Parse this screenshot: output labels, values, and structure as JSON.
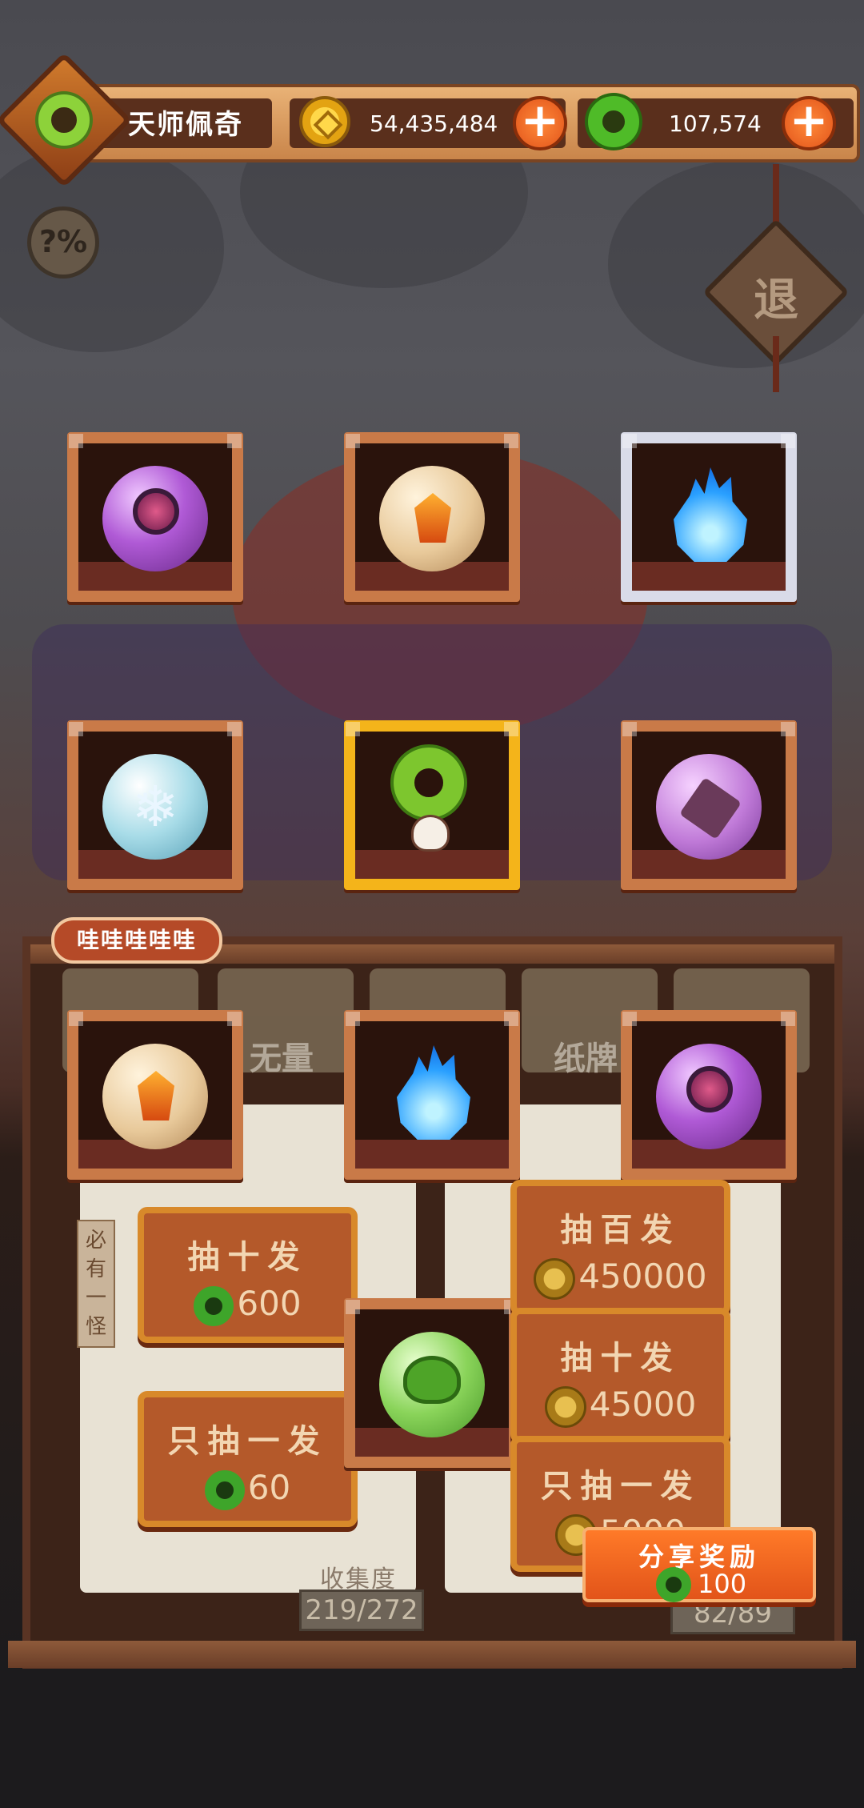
{
  "header": {
    "player_name": "天师佩奇",
    "gold_amount": "54,435,484",
    "jade_amount": "107,574",
    "plus_label": "+"
  },
  "buttons": {
    "odds_label": "?%",
    "exit_label": "退"
  },
  "prizes": [
    {
      "item": "purple-orb",
      "frame": "bronze"
    },
    {
      "item": "tan-fire-orb",
      "frame": "bronze"
    },
    {
      "item": "blue-flame",
      "frame": "silver"
    },
    {
      "item": "ice-orb",
      "frame": "bronze"
    },
    {
      "item": "green-ring-ghost",
      "frame": "gold"
    },
    {
      "item": "lavender-orb",
      "frame": "bronze"
    },
    {
      "item": "tan-fire-orb",
      "frame": "bronze"
    },
    {
      "item": "blue-flame",
      "frame": "bronze"
    },
    {
      "item": "purple-orb",
      "frame": "bronze"
    },
    {
      "item": "green-orb",
      "frame": "bronze"
    }
  ],
  "speech_bubble": "哇哇哇哇哇",
  "tabs": [
    {
      "label": ""
    },
    {
      "label": "无量"
    },
    {
      "label": ""
    },
    {
      "label": "纸牌"
    },
    {
      "label": ""
    }
  ],
  "left_panel": {
    "tag": "必有一怪",
    "draw_ten": {
      "label": "抽十发",
      "cost": "600"
    },
    "draw_one": {
      "label": "只抽一发",
      "cost": "60"
    },
    "collect_label": "收集度",
    "collect_count": "219/272"
  },
  "right_panel": {
    "draw_hundred": {
      "label": "抽百发",
      "cost": "450000"
    },
    "draw_ten": {
      "label": "抽十发",
      "cost": "45000"
    },
    "draw_one": {
      "label": "只抽一发",
      "cost": "5000"
    },
    "collect_count": "82/89"
  },
  "share": {
    "label": "分享奖励",
    "reward": "100"
  },
  "colors": {
    "accent_orange": "#e2541a",
    "gold_frame": "#f4b41a",
    "bronze_frame": "#c97a48",
    "silver_frame": "#d9dbe8",
    "jade_green": "#4fbb28"
  }
}
